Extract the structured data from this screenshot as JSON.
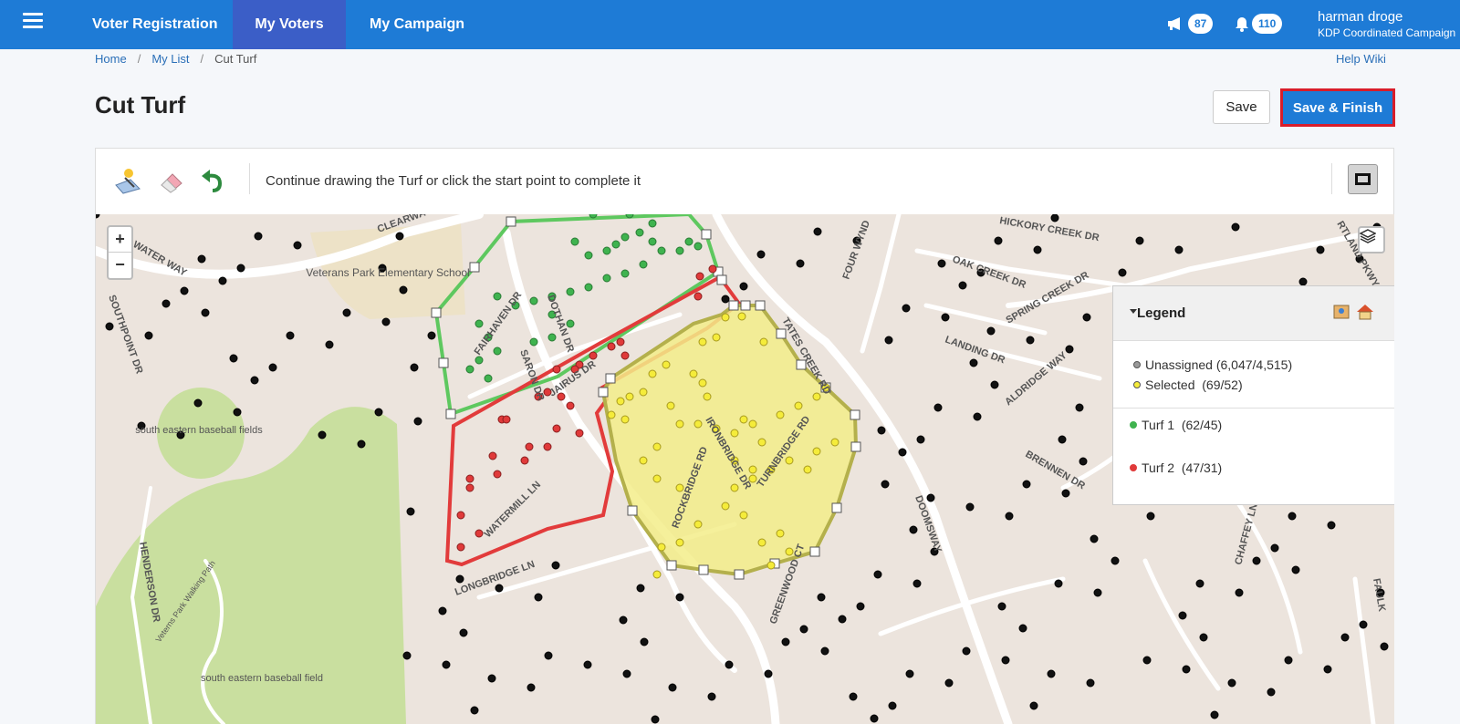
{
  "nav": {
    "items": [
      "Voter Registration",
      "My Voters",
      "My Campaign"
    ],
    "active": "My Voters",
    "announcement_count": "87",
    "notification_count": "110",
    "user_name": "harman droge",
    "user_org": "KDP Coordinated Campaign"
  },
  "breadcrumb": [
    "Home",
    "My List",
    "Cut Turf"
  ],
  "help_link": "Help Wiki",
  "page_title": "Cut Turf",
  "buttons": {
    "save": "Save",
    "save_finish": "Save & Finish"
  },
  "toolbar": {
    "instruction": "Continue drawing the Turf or click the start point to complete it",
    "tools": [
      "draw-turf-icon",
      "eraser-icon",
      "undo-icon",
      "fullscreen-icon"
    ]
  },
  "map": {
    "zoom_in": "+",
    "zoom_out": "−",
    "labels": [
      "WATER WAY",
      "CLEARWA",
      "Veterans Park Elementary School",
      "SOUTHPOINT DR",
      "south eastern baseball fields",
      "south eastern baseball field",
      "Veterns Park Walking Path",
      "HENDERSON DR",
      "FAIRHAVEN DR",
      "DOTHAN DR",
      "SARON DR",
      "JAIRUS DR",
      "WATERMILL LN",
      "LONGBRIDGE LN",
      "ROCKBRIDGE RD",
      "IRONBRIDGE DR",
      "TURNBRIDGE RD",
      "TATES CREEK RD",
      "FOUR WYND",
      "OAK CREEK DR",
      "HICKORY CREEK DR",
      "SPRING CREEK DR",
      "LANDING DR",
      "ALDRIDGE WAY",
      "BRENNEN DR",
      "CHAFFEY LN",
      "GREENWOOD CT",
      "DOOMSWAY",
      "RTLAND PKWY",
      "FAULK"
    ],
    "colors": {
      "turf1": "#3fb34f",
      "turf2": "#e03a3a",
      "selected": "#f5ec3a",
      "unassigned": "#111111"
    }
  },
  "legend": {
    "title": "Legend",
    "items": [
      {
        "label": "Unassigned",
        "count": "(6,047/4,515)",
        "color": "#9a9a9a"
      },
      {
        "label": "Selected",
        "count": "(69/52)",
        "color": "#f5ec3a"
      },
      {
        "label": "Turf 1",
        "count": "(62/45)",
        "color": "#3fb34f"
      },
      {
        "label": "Turf 2",
        "count": "(47/31)",
        "color": "#e03a3a"
      }
    ]
  }
}
